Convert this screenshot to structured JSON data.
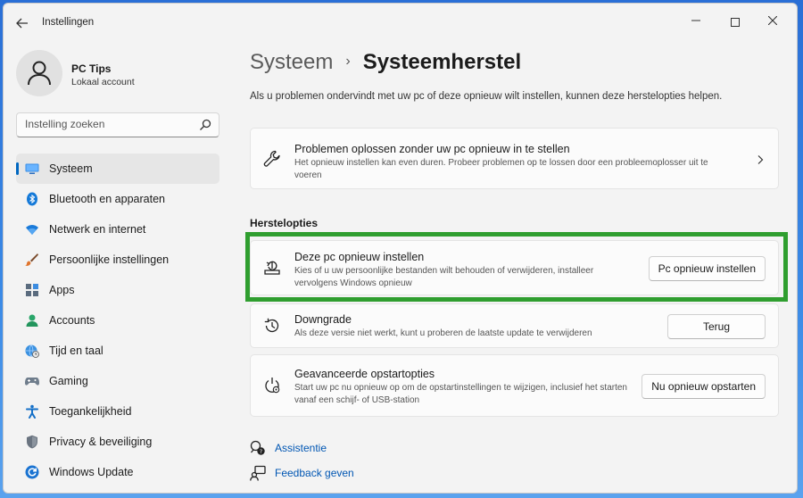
{
  "app": {
    "title": "Instellingen",
    "back_icon": "arrow-left-icon",
    "window_controls": [
      "minimize",
      "maximize",
      "close"
    ]
  },
  "profile": {
    "name": "PC Tips",
    "account_type": "Lokaal account"
  },
  "search": {
    "placeholder": "Instelling zoeken"
  },
  "sidebar": {
    "items": [
      {
        "label": "Systeem",
        "icon": "monitor-icon",
        "active": true
      },
      {
        "label": "Bluetooth en apparaten",
        "icon": "bluetooth-icon"
      },
      {
        "label": "Netwerk en internet",
        "icon": "wifi-icon"
      },
      {
        "label": "Persoonlijke instellingen",
        "icon": "brush-icon"
      },
      {
        "label": "Apps",
        "icon": "apps-icon"
      },
      {
        "label": "Accounts",
        "icon": "person-icon"
      },
      {
        "label": "Tijd en taal",
        "icon": "globe-clock-icon"
      },
      {
        "label": "Gaming",
        "icon": "gamepad-icon"
      },
      {
        "label": "Toegankelijkheid",
        "icon": "accessibility-icon"
      },
      {
        "label": "Privacy & beveiliging",
        "icon": "shield-icon"
      },
      {
        "label": "Windows Update",
        "icon": "update-icon"
      }
    ]
  },
  "main": {
    "breadcrumb": {
      "parent": "Systeem",
      "separator": "›",
      "current": "Systeemherstel"
    },
    "intro": "Als u problemen ondervindt met uw pc of deze opnieuw wilt instellen, kunnen deze herstelopties helpen.",
    "troubleshoot": {
      "title": "Problemen oplossen zonder uw pc opnieuw in te stellen",
      "description": "Het opnieuw instellen kan even duren. Probeer problemen op te lossen door een probleemoplosser uit te voeren",
      "icon": "wrench-icon"
    },
    "section_title": "Herstelopties",
    "options": [
      {
        "title": "Deze pc opnieuw instellen",
        "description": "Kies of u uw persoonlijke bestanden wilt behouden of verwijderen, installeer vervolgens Windows opnieuw",
        "button": "Pc opnieuw instellen",
        "icon": "reset-pc-icon"
      },
      {
        "title": "Downgrade",
        "description": "Als deze versie niet werkt, kunt u proberen de laatste update te verwijderen",
        "button": "Terug",
        "icon": "history-icon"
      },
      {
        "title": "Geavanceerde opstartopties",
        "description": "Start uw pc nu opnieuw op om de opstartinstellingen te wijzigen, inclusief het starten vanaf een schijf- of USB-station",
        "button": "Nu opnieuw opstarten",
        "icon": "advanced-startup-icon"
      }
    ],
    "links": [
      {
        "label": "Assistentie",
        "icon": "help-chat-icon"
      },
      {
        "label": "Feedback geven",
        "icon": "feedback-icon"
      }
    ]
  },
  "colors": {
    "accent": "#0067c0",
    "highlight": "#2f9e2f",
    "link": "#0056b3"
  }
}
